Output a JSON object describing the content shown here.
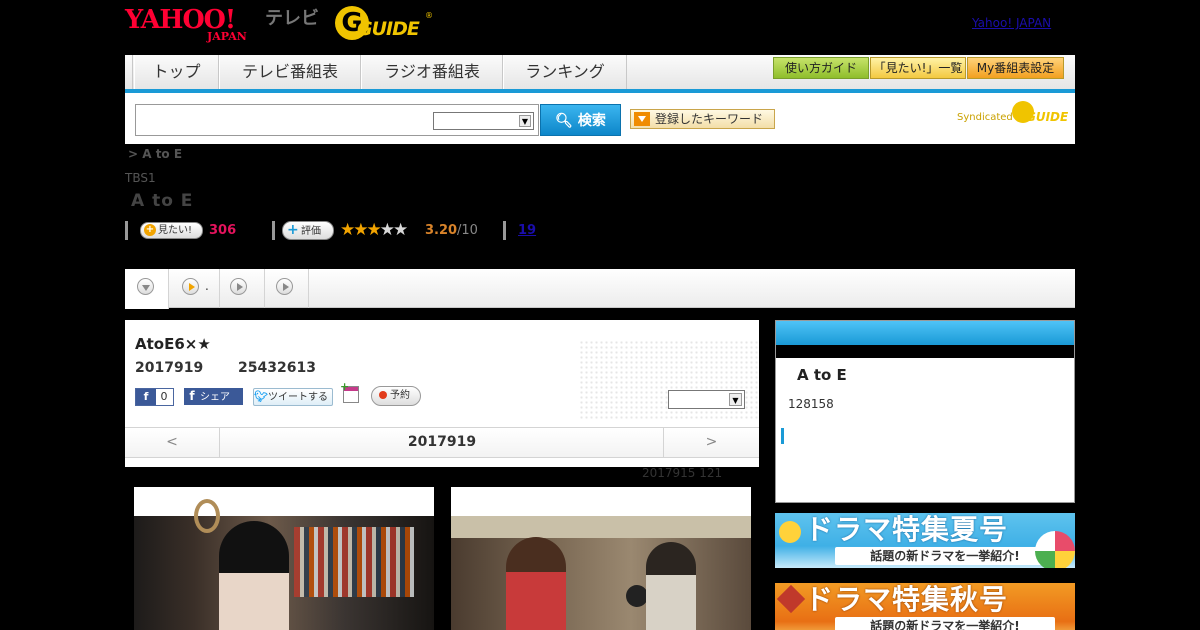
{
  "header": {
    "yahoo_logo": "YAHOO!",
    "yahoo_sub": "JAPAN",
    "tv_label": "テレビ",
    "gguide_g": "G",
    "gguide_text": "GUIDE",
    "gguide_reg": "®",
    "yahoo_japan_link": "Yahoo! JAPAN"
  },
  "nav": {
    "tabs": [
      {
        "label": "トップ"
      },
      {
        "label": "テレビ番組表"
      },
      {
        "label": "ラジオ番組表"
      },
      {
        "label": "ランキング"
      }
    ],
    "util": {
      "guide_label": "使い方ガイド",
      "want_list_label": "「見たい!」一覧",
      "my_table_label": "My番組表設定"
    }
  },
  "search": {
    "input_value": "",
    "select_value": "",
    "button_label": "検索",
    "keyword_button_label": "登録したキーワード",
    "syndicated_label": "Syndicated",
    "synd_logo_text": "GUIDE"
  },
  "program": {
    "breadcrumb": ">  A to E",
    "channel": "TBS1",
    "title": "A to E",
    "mitai_label": "見たい!",
    "mitai_count": "306",
    "rating_label": "評価",
    "stars_on": "★★★",
    "stars_off": "★★",
    "rating_value": "3.20",
    "rating_denominator": "/10",
    "review_count": "19"
  },
  "subtabs": {
    "second_label": "."
  },
  "episode": {
    "title": "AtoE6×★",
    "date": "2017919",
    "time": "25432613",
    "fb_like_count": "0",
    "fb_share_label": "シェア",
    "tweet_label": "ツイートする",
    "reserve_label": "予約",
    "select_value": "",
    "nav_prev": "<",
    "nav_current": "2017919",
    "nav_next": ">",
    "note": "2017915  121"
  },
  "sidebar": {
    "title": "A to E",
    "id_value": "128158"
  },
  "banners": {
    "summer": {
      "big": "ドラマ特集夏号",
      "sub": "話題の新ドラマを一挙紹介!"
    },
    "autumn": {
      "big": "ドラマ特集秋号",
      "sub": "話題の新ドラマを一挙紹介!"
    }
  },
  "colors": {
    "accent_blue": "#1a9ad6",
    "yahoo_red": "#ff0033",
    "gguide_yellow": "#f0c400",
    "mitai_pink": "#e5135d",
    "star_orange": "#f2a400"
  }
}
